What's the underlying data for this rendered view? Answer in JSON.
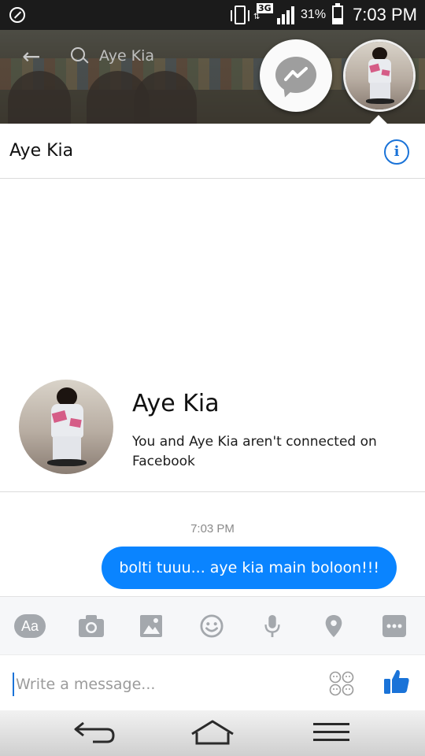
{
  "status_bar": {
    "network": "3G",
    "battery_percent": "31%",
    "battery_level": 0.31,
    "time": "7:03 PM",
    "icons": [
      "circle-slash-icon",
      "vibrate-icon",
      "3g-data-icon",
      "signal-icon",
      "battery-icon"
    ]
  },
  "background_page": {
    "search_text": "Aye Kia",
    "icons": [
      "back-arrow-icon",
      "search-icon"
    ]
  },
  "chat_heads": {
    "messenger_icon": "messenger-icon",
    "avatar_icon": "profile-photo"
  },
  "conversation": {
    "title": "Aye Kia",
    "info_icon": "info-icon",
    "info_glyph": "i"
  },
  "profile": {
    "name": "Aye Kia",
    "subtitle": "You and Aye Kia aren't connected on Facebook"
  },
  "messages": [
    {
      "time": "7:03 PM",
      "text": "bolti tuuu... aye kia main boloon!!!",
      "sender": "me",
      "color": "#0a84ff"
    }
  ],
  "toolbar": {
    "text_format_label": "Aa",
    "items": [
      "text-format-icon",
      "camera-icon",
      "gallery-icon",
      "emoji-icon",
      "microphone-icon",
      "location-icon",
      "more-icon"
    ]
  },
  "composer": {
    "placeholder": "Write a message...",
    "sticker_icon": "sticker-icon",
    "send_icon": "like-icon",
    "accent": "#1a73d8"
  },
  "nav_bar": {
    "items": [
      "back-nav-icon",
      "home-nav-icon",
      "menu-nav-icon"
    ]
  }
}
